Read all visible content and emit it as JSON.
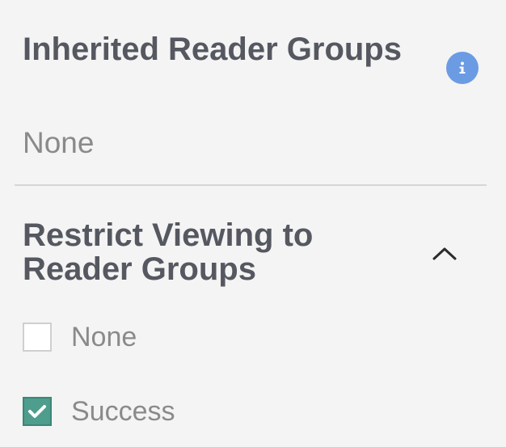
{
  "inherited": {
    "title": "Inherited Reader Groups",
    "value": "None",
    "icon": "info-icon",
    "icon_color": "#6b9be3"
  },
  "restrict": {
    "title": "Restrict Viewing to Reader Groups",
    "toggle_icon": "chevron-up-icon",
    "options": [
      {
        "label": "None",
        "checked": false
      },
      {
        "label": "Success",
        "checked": true
      }
    ],
    "checked_color": "#4f9e8d"
  }
}
